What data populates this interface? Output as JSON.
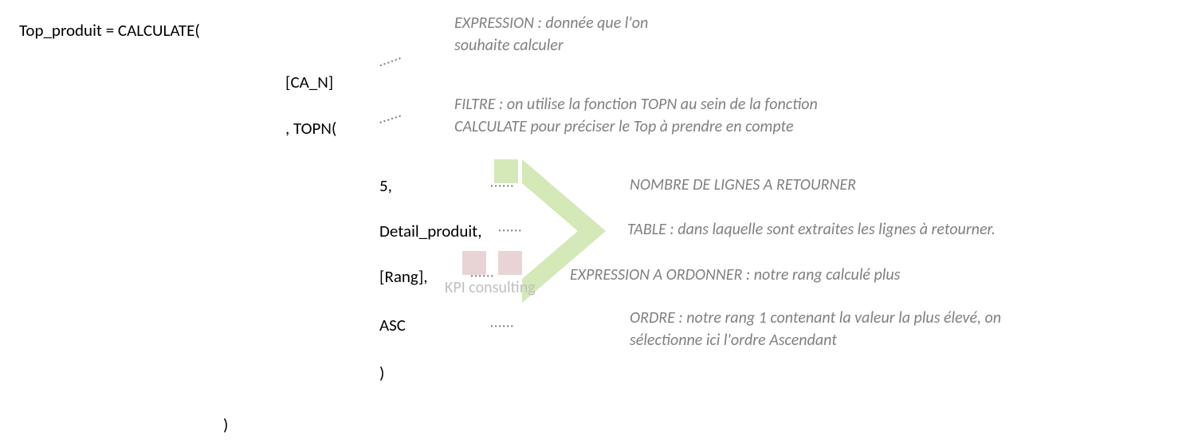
{
  "code": {
    "line1": "Top_produit = CALCULATE(",
    "arg1": "[CA_N]",
    "arg2": ", TOPN(",
    "sub1": "5,",
    "sub2": "Detail_produit,",
    "sub3": "[Rang],",
    "sub4": "ASC",
    "sub5": ")",
    "close": ")"
  },
  "annotations": {
    "expr_line1": "EXPRESSION : donnée que l'on",
    "expr_line2": "souhaite calculer",
    "filtre_line1": "FILTRE : on utilise la fonction TOPN au sein de la fonction",
    "filtre_line2": "CALCULATE pour préciser le Top à prendre en compte",
    "nlignes": "NOMBRE DE LIGNES A RETOURNER",
    "table": "TABLE : dans laquelle sont extraites les lignes à retourner.",
    "exprord": "EXPRESSION A ORDONNER : notre rang calculé plus",
    "ordre_line1": "ORDRE : notre rang 1 contenant la valeur la plus élevé, on",
    "ordre_line2": "sélectionne ici l'ordre Ascendant"
  },
  "dots": "······",
  "watermark": "KPI consulting"
}
